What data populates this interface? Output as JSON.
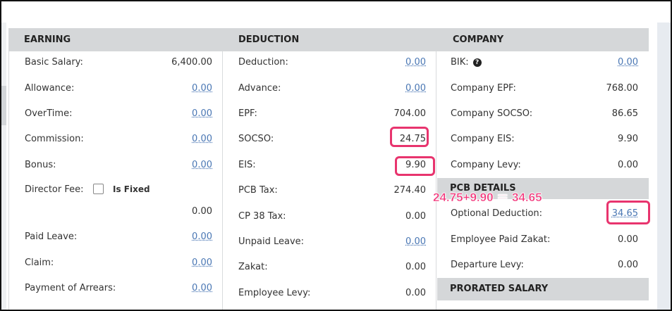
{
  "earning": {
    "header": "EARNING",
    "rows": [
      {
        "label": "Basic Salary:",
        "value": "6,400.00"
      },
      {
        "label": "Allowance:",
        "value": "0.00"
      },
      {
        "label": "OverTime:",
        "value": "0.00"
      },
      {
        "label": "Commission:",
        "value": "0.00"
      },
      {
        "label": "Bonus:",
        "value": "0.00"
      },
      {
        "label": "Director Fee:",
        "value": "0.00"
      },
      {
        "label": "Paid Leave:",
        "value": "0.00"
      },
      {
        "label": "Claim:",
        "value": "0.00"
      },
      {
        "label": "Payment of Arrears:",
        "value": "0.00"
      }
    ],
    "is_fixed_label": "Is Fixed"
  },
  "deduction": {
    "header": "DEDUCTION",
    "rows": [
      {
        "label": "Deduction:",
        "value": "0.00"
      },
      {
        "label": "Advance:",
        "value": "0.00"
      },
      {
        "label": "EPF:",
        "value": "704.00"
      },
      {
        "label": "SOCSO:",
        "value": "24.75"
      },
      {
        "label": "EIS:",
        "value": "9.90"
      },
      {
        "label": "PCB Tax:",
        "value": "274.40"
      },
      {
        "label": "CP 38 Tax:",
        "value": "0.00"
      },
      {
        "label": "Unpaid Leave:",
        "value": "0.00"
      },
      {
        "label": "Zakat:",
        "value": "0.00"
      },
      {
        "label": "Employee Levy:",
        "value": "0.00"
      }
    ]
  },
  "company": {
    "header": "COMPANY",
    "rows": [
      {
        "label": "BIK:",
        "value": "0.00"
      },
      {
        "label": "Company EPF:",
        "value": "768.00"
      },
      {
        "label": "Company SOCSO:",
        "value": "86.65"
      },
      {
        "label": "Company EIS:",
        "value": "9.90"
      },
      {
        "label": "Company Levy:",
        "value": "0.00"
      }
    ],
    "pcb_header": "PCB DETAILS",
    "pcb_rows": [
      {
        "label": "Optional Deduction:",
        "value": "34.65"
      },
      {
        "label": "Employee Paid Zakat:",
        "value": "0.00"
      },
      {
        "label": "Departure Levy:",
        "value": "0.00"
      }
    ],
    "prorated_header": "PRORATED SALARY"
  },
  "annotation": {
    "formula": "24.75+9.90 ＝ 34.65"
  },
  "colors": {
    "header_bg": "#d5d7d9",
    "link": "#4a77b4",
    "highlight": "#e8346e"
  },
  "icons": {
    "help": "question-circle-icon"
  }
}
